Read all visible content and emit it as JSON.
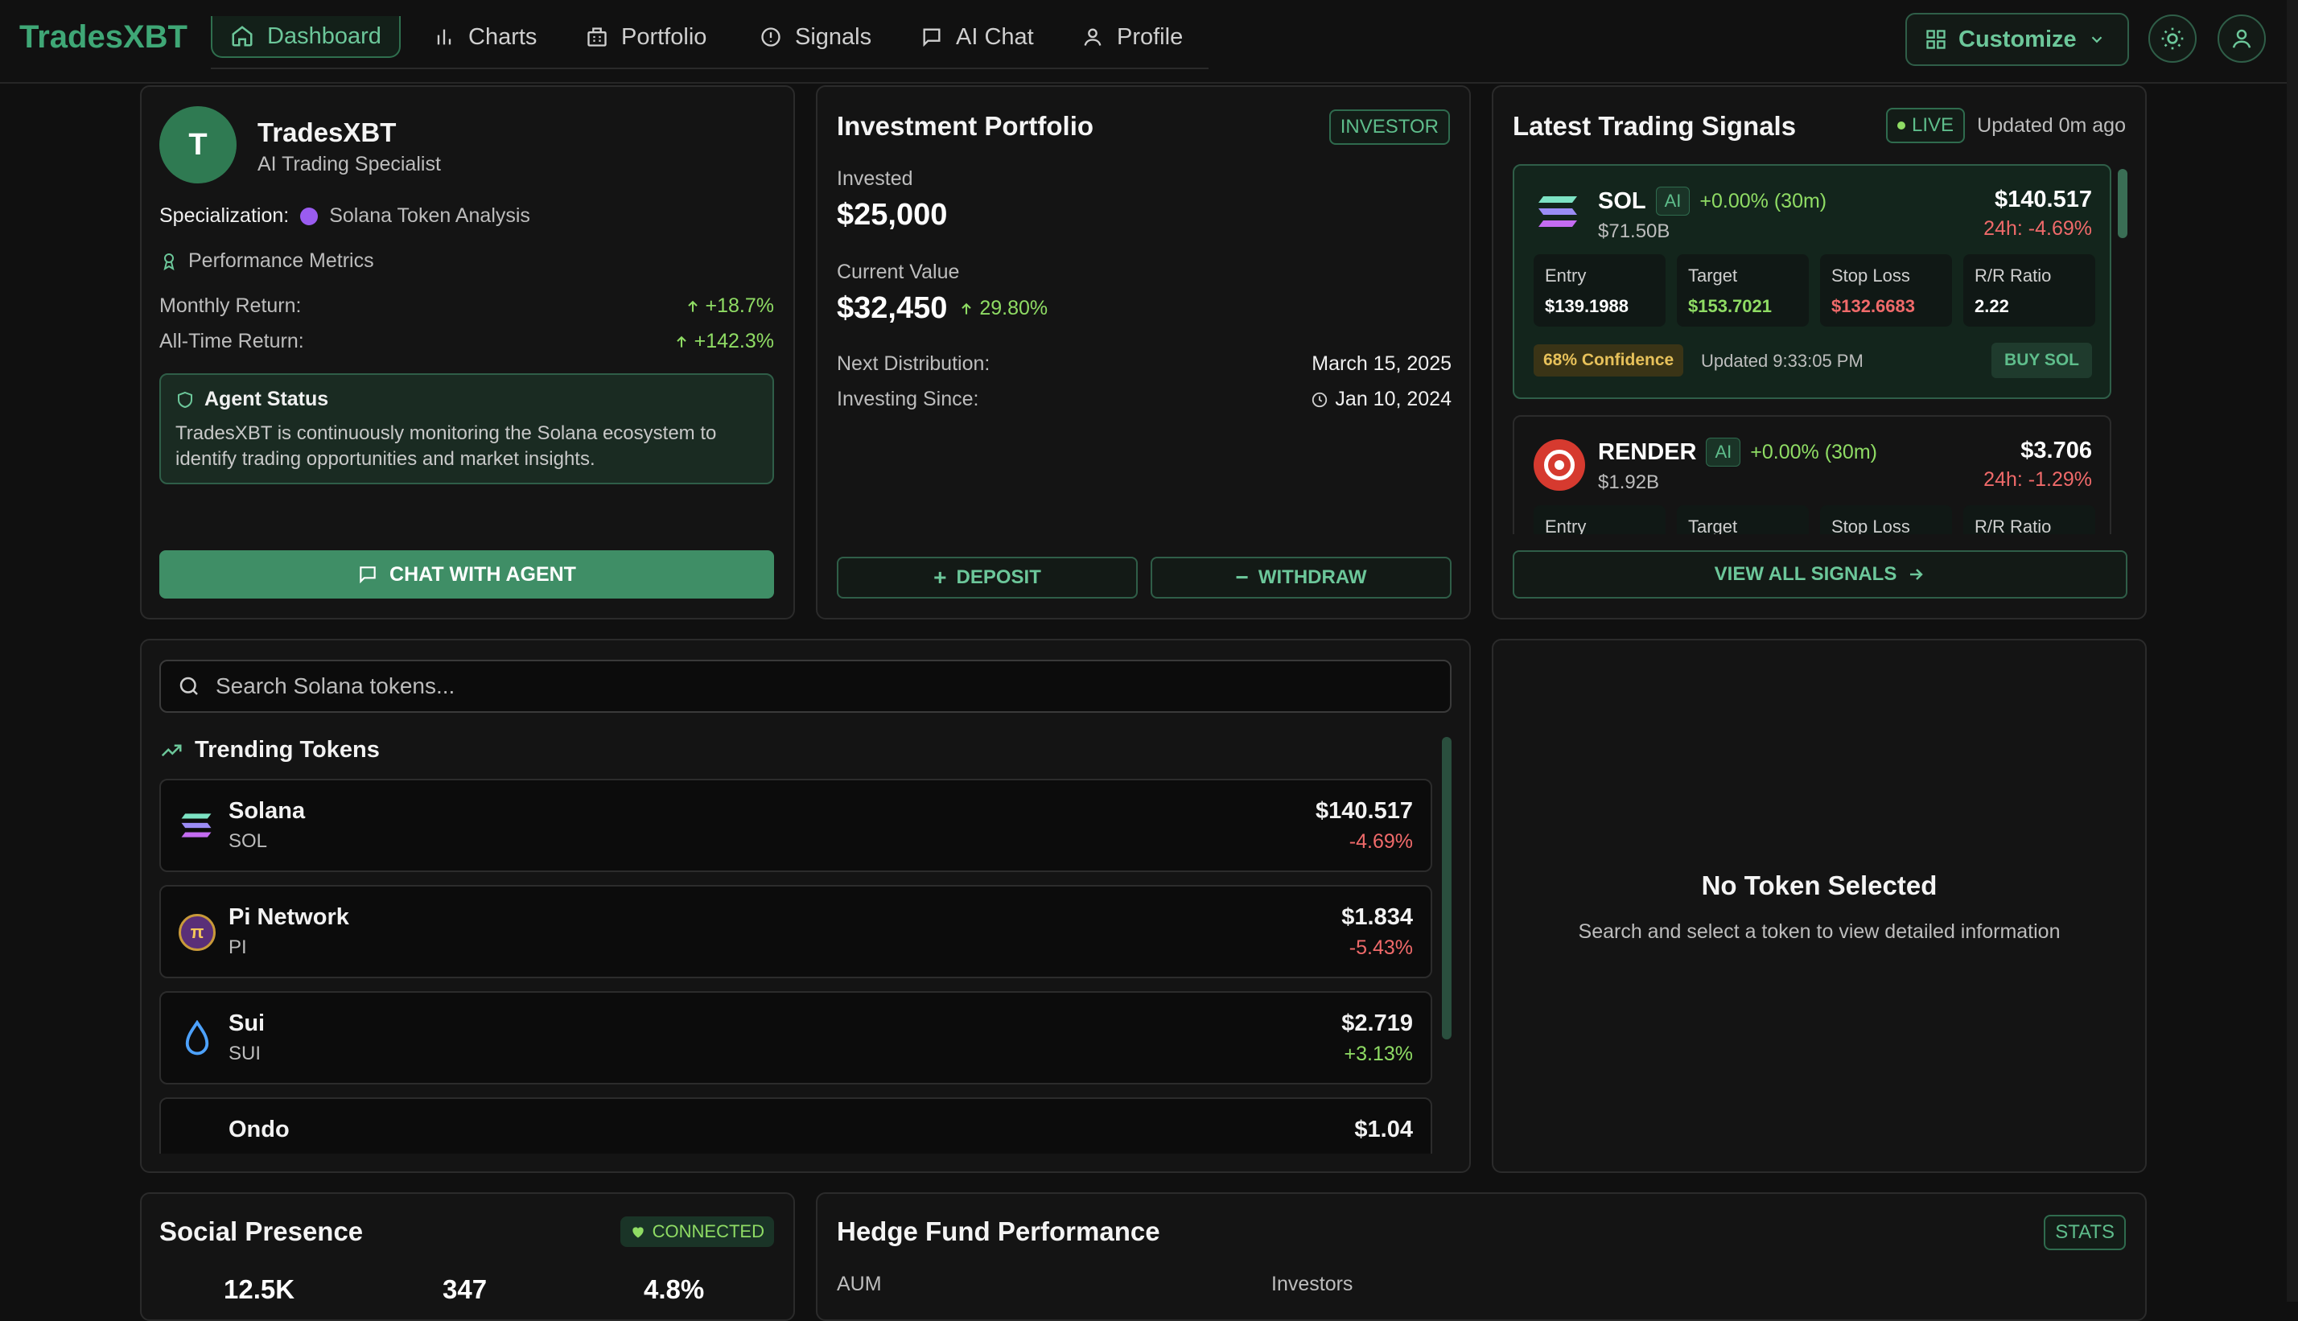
{
  "app": {
    "name": "TradesXBT"
  },
  "nav": {
    "tabs": [
      {
        "label": "Dashboard",
        "icon": "home-icon"
      },
      {
        "label": "Charts",
        "icon": "bar-chart-icon"
      },
      {
        "label": "Portfolio",
        "icon": "building-icon"
      },
      {
        "label": "Signals",
        "icon": "alert-circle-icon"
      },
      {
        "label": "AI Chat",
        "icon": "chat-icon"
      },
      {
        "label": "Profile",
        "icon": "user-icon"
      }
    ],
    "customize_label": "Customize"
  },
  "agent": {
    "avatar_letter": "T",
    "name": "TradesXBT",
    "role": "AI Trading Specialist",
    "specialization_label": "Specialization:",
    "specialization_value": "Solana Token Analysis",
    "metrics_heading": "Performance Metrics",
    "monthly_label": "Monthly Return:",
    "monthly_value": "+18.7%",
    "alltime_label": "All-Time Return:",
    "alltime_value": "+142.3%",
    "status_title": "Agent Status",
    "status_text": "TradesXBT is continuously monitoring the Solana ecosystem to identify trading opportunities and market insights.",
    "chat_button": "CHAT WITH AGENT"
  },
  "portfolio": {
    "title": "Investment Portfolio",
    "badge": "INVESTOR",
    "invested_label": "Invested",
    "invested_value": "$25,000",
    "current_label": "Current Value",
    "current_value": "$32,450",
    "current_change": "29.80%",
    "next_dist_label": "Next Distribution:",
    "next_dist_value": "March 15, 2025",
    "since_label": "Investing Since:",
    "since_value": "Jan 10, 2024",
    "deposit_label": "DEPOSIT",
    "withdraw_label": "WITHDRAW"
  },
  "signals": {
    "title": "Latest Trading Signals",
    "live_label": "LIVE",
    "updated_label": "Updated 0m ago",
    "items": [
      {
        "symbol": "SOL",
        "ai": "AI",
        "change": "+0.00% (30m)",
        "mcap": "$71.50B",
        "price": "$140.517",
        "change24": "24h: -4.69%",
        "entry_label": "Entry",
        "entry": "$139.1988",
        "target_label": "Target",
        "target": "$153.7021",
        "stop_label": "Stop Loss",
        "stop": "$132.6683",
        "rr_label": "R/R Ratio",
        "rr": "2.22",
        "confidence": "68% Confidence",
        "updated": "Updated 9:33:05 PM",
        "action": "BUY SOL"
      },
      {
        "symbol": "RENDER",
        "ai": "AI",
        "change": "+0.00% (30m)",
        "mcap": "$1.92B",
        "price": "$3.706",
        "change24": "24h: -1.29%",
        "entry_label": "Entry",
        "target_label": "Target",
        "stop_label": "Stop Loss",
        "rr_label": "R/R Ratio"
      }
    ],
    "view_all": "VIEW ALL SIGNALS"
  },
  "search": {
    "placeholder": "Search Solana tokens...",
    "trending_title": "Trending Tokens",
    "tokens": [
      {
        "name": "Solana",
        "symbol": "SOL",
        "price": "$140.517",
        "change": "-4.69%"
      },
      {
        "name": "Pi Network",
        "symbol": "PI",
        "price": "$1.834",
        "change": "-5.43%"
      },
      {
        "name": "Sui",
        "symbol": "SUI",
        "price": "$2.719",
        "change": "+3.13%"
      },
      {
        "name": "Ondo",
        "symbol": "",
        "price": "$1.04",
        "change": ""
      }
    ]
  },
  "detail": {
    "title": "No Token Selected",
    "subtitle": "Search and select a token to view detailed information"
  },
  "social": {
    "title": "Social Presence",
    "badge": "CONNECTED",
    "stats": [
      "12.5K",
      "347",
      "4.8%"
    ]
  },
  "hedge": {
    "title": "Hedge Fund Performance",
    "badge": "STATS",
    "aum_label": "AUM",
    "investors_label": "Investors"
  }
}
